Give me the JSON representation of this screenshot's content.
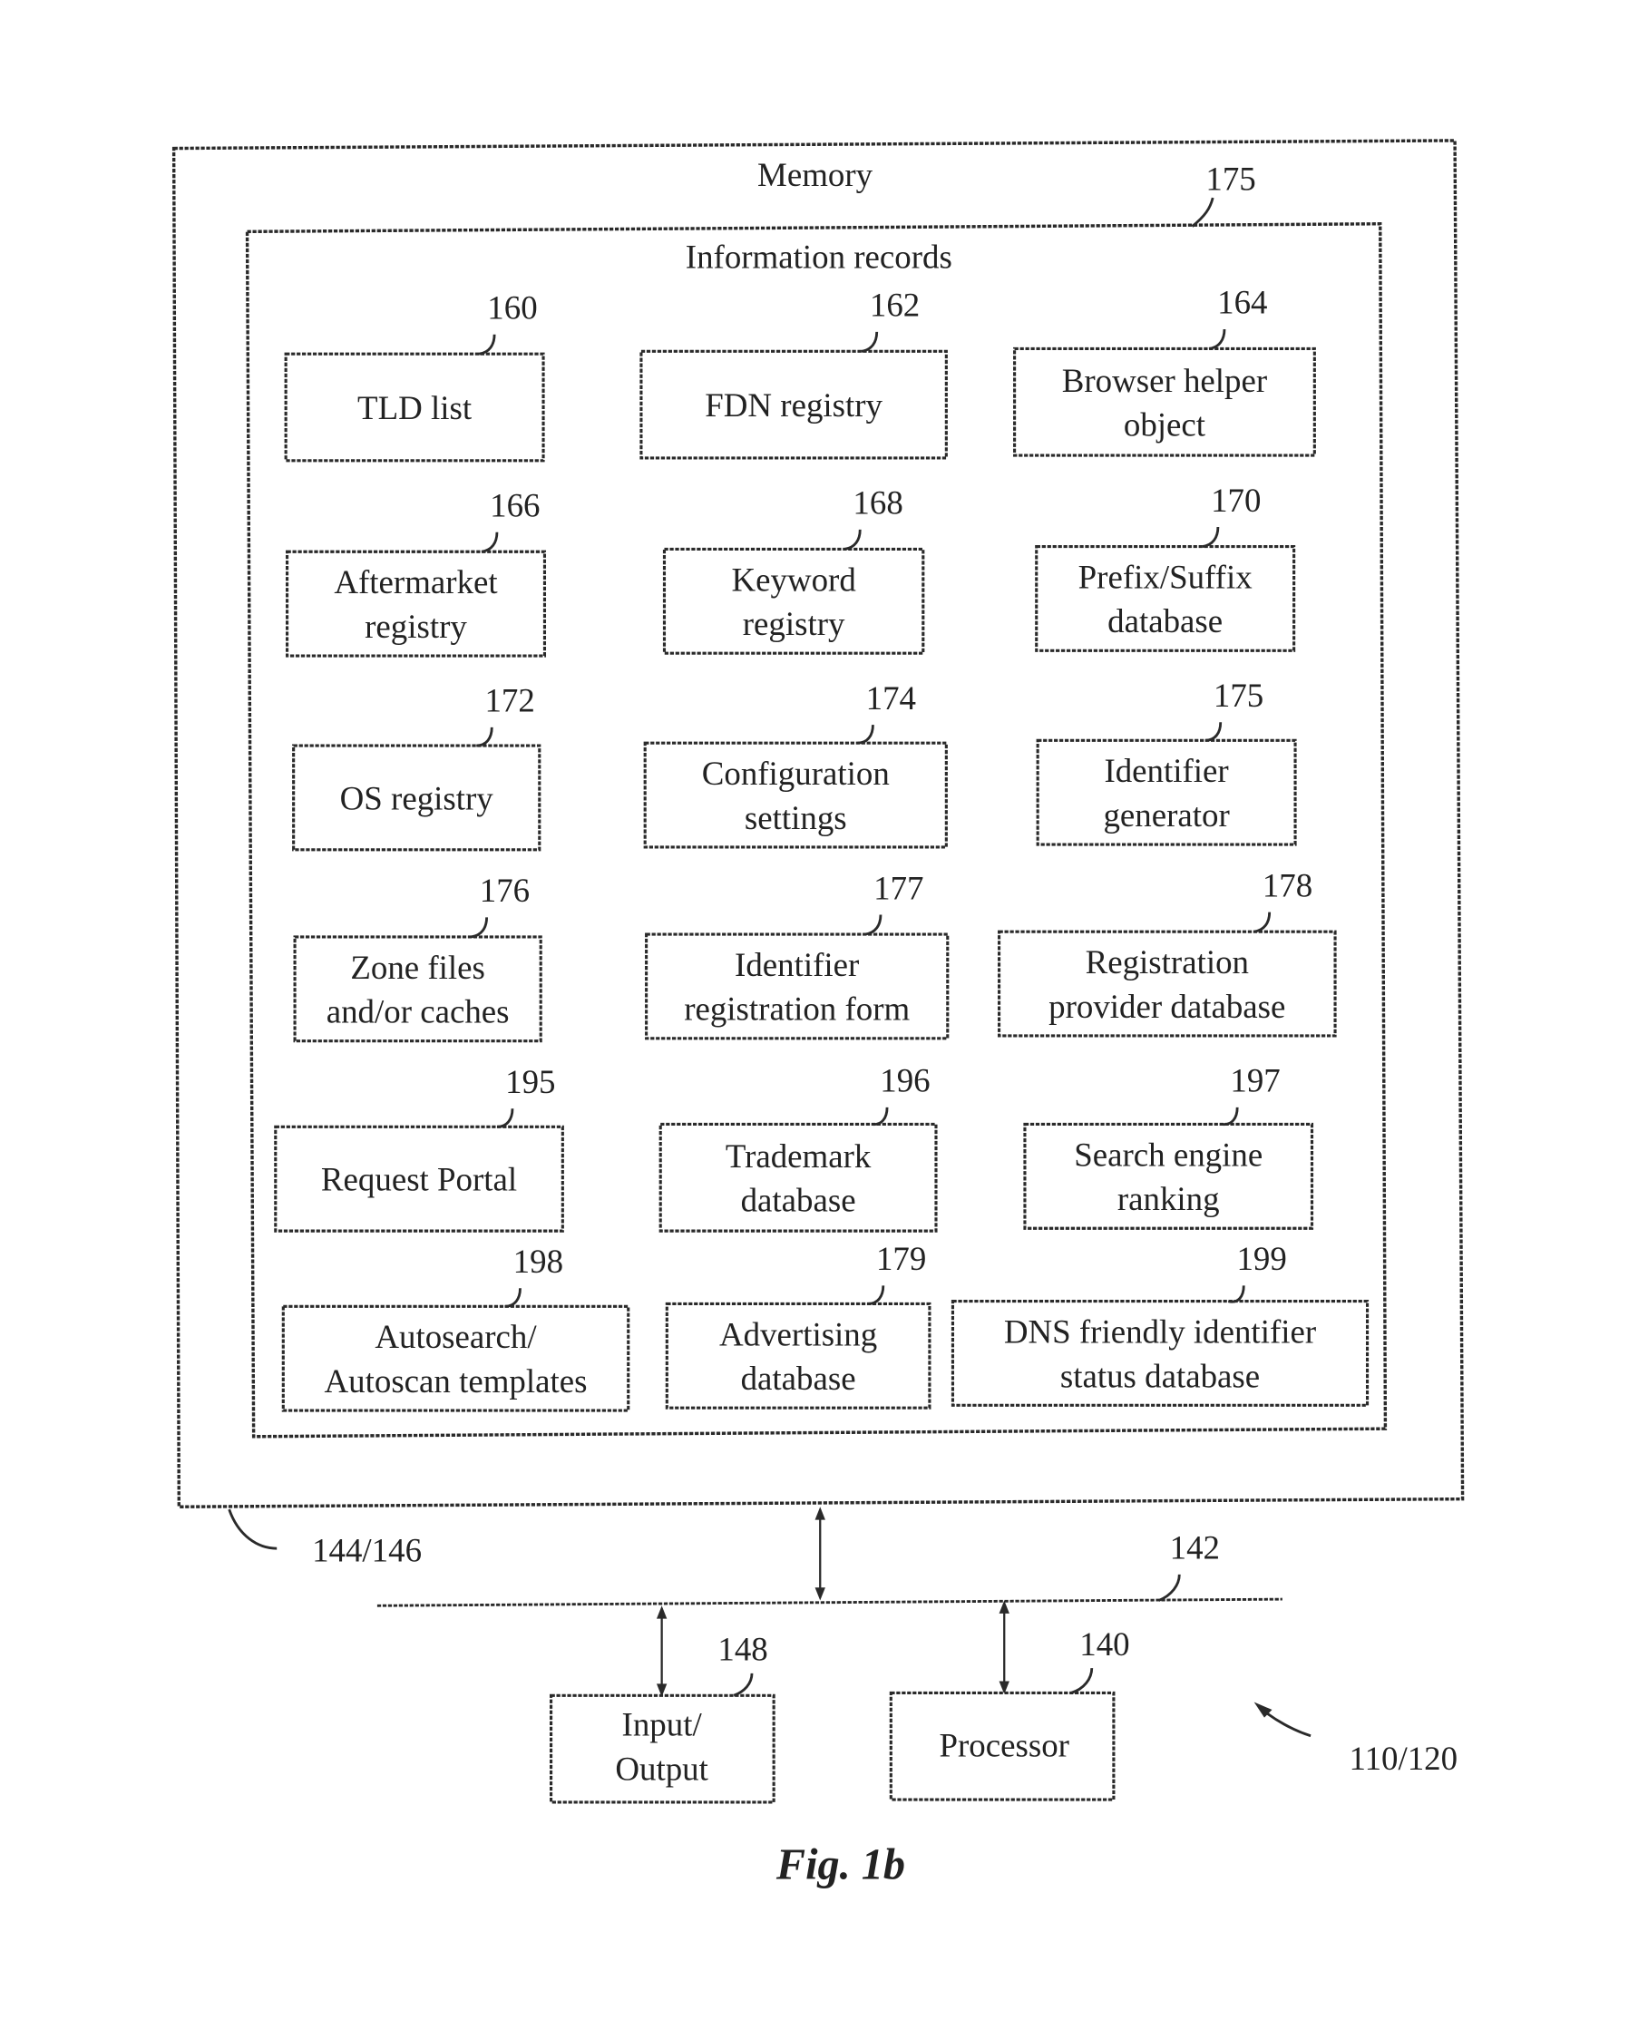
{
  "figure": {
    "caption": "Fig. 1b",
    "system_ref": "110/120"
  },
  "memory": {
    "title": "Memory",
    "ref": "144/146"
  },
  "info_records": {
    "title": "Information records",
    "ref": "175"
  },
  "records": [
    {
      "ref": "160",
      "lines": [
        "TLD list"
      ]
    },
    {
      "ref": "162",
      "lines": [
        "FDN registry"
      ]
    },
    {
      "ref": "164",
      "lines": [
        "Browser helper",
        "object"
      ]
    },
    {
      "ref": "166",
      "lines": [
        "Aftermarket",
        "registry"
      ]
    },
    {
      "ref": "168",
      "lines": [
        "Keyword",
        "registry"
      ]
    },
    {
      "ref": "170",
      "lines": [
        "Prefix/Suffix",
        "database"
      ]
    },
    {
      "ref": "172",
      "lines": [
        "OS registry"
      ]
    },
    {
      "ref": "174",
      "lines": [
        "Configuration",
        "settings"
      ]
    },
    {
      "ref": "175",
      "lines": [
        "Identifier",
        "generator"
      ]
    },
    {
      "ref": "176",
      "lines": [
        "Zone files",
        "and/or caches"
      ]
    },
    {
      "ref": "177",
      "lines": [
        "Identifier",
        "registration form"
      ]
    },
    {
      "ref": "178",
      "lines": [
        "Registration",
        "provider database"
      ]
    },
    {
      "ref": "195",
      "lines": [
        "Request Portal"
      ]
    },
    {
      "ref": "196",
      "lines": [
        "Trademark",
        "database"
      ]
    },
    {
      "ref": "197",
      "lines": [
        "Search engine",
        "ranking"
      ]
    },
    {
      "ref": "198",
      "lines": [
        "Autosearch/",
        "Autoscan templates"
      ]
    },
    {
      "ref": "179",
      "lines": [
        "Advertising",
        "database"
      ]
    },
    {
      "ref": "199",
      "lines": [
        "DNS friendly identifier",
        "status database"
      ]
    }
  ],
  "bus": {
    "ref": "142"
  },
  "io": {
    "ref": "148",
    "lines": [
      "Input/",
      "Output"
    ]
  },
  "processor": {
    "ref": "140",
    "lines": [
      "Processor"
    ]
  }
}
